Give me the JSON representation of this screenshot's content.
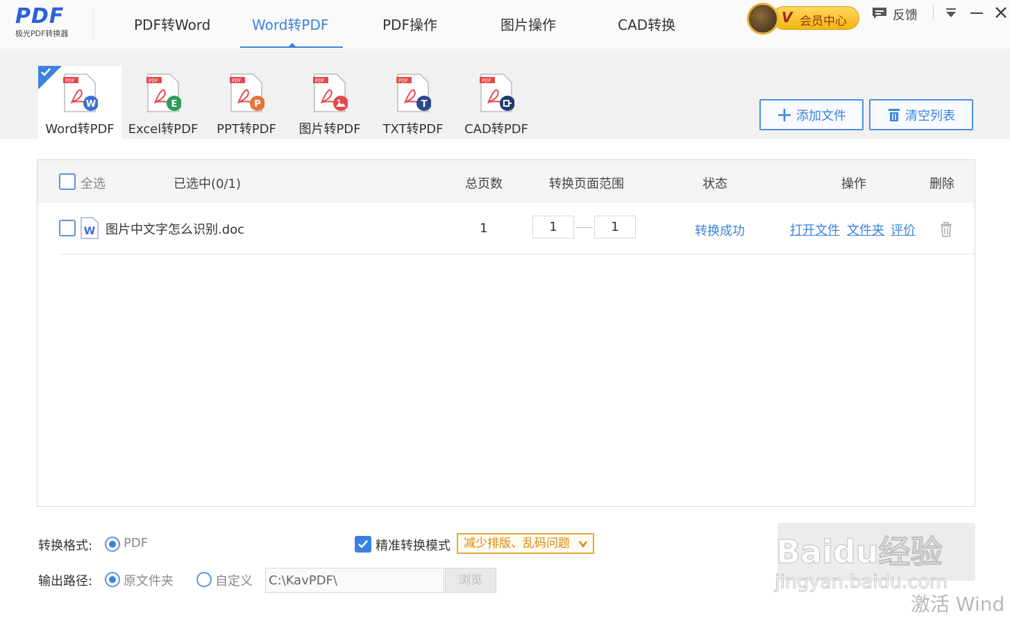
{
  "app": {
    "logo_mark": "PDF",
    "logo_sub": "极光PDF转换器"
  },
  "nav": {
    "tabs": [
      {
        "label": "PDF转Word"
      },
      {
        "label": "Word转PDF"
      },
      {
        "label": "PDF操作"
      },
      {
        "label": "图片操作"
      },
      {
        "label": "CAD转换"
      }
    ],
    "active_index": 1
  },
  "header": {
    "vip_mark": "V",
    "vip_label": "会员中心",
    "feedback_label": "反馈"
  },
  "tools": {
    "items": [
      {
        "label": "Word转PDF",
        "badge": "W",
        "badge_color": "#3b6fd6"
      },
      {
        "label": "Excel转PDF",
        "badge": "E",
        "badge_color": "#2e9a5a"
      },
      {
        "label": "PPT转PDF",
        "badge": "P",
        "badge_color": "#e4743a"
      },
      {
        "label": "图片转PDF",
        "badge": "",
        "badge_color": "#e5484d"
      },
      {
        "label": "TXT转PDF",
        "badge": "T",
        "badge_color": "#2b4a8a"
      },
      {
        "label": "CAD转PDF",
        "badge": "",
        "badge_color": "#1f3b73"
      }
    ],
    "active_index": 0,
    "doc_tag": "PDF",
    "add_file_label": "添加文件",
    "clear_list_label": "清空列表"
  },
  "table": {
    "select_all_label": "全选",
    "selected_count_label": "已选中(0/1)",
    "columns": {
      "total_pages": "总页数",
      "page_range": "转换页面范围",
      "status": "状态",
      "actions": "操作",
      "delete": "删除"
    },
    "rows": [
      {
        "checked": false,
        "file_name": "图片中文字怎么识别.doc",
        "total_pages": "1",
        "range_from": "1",
        "range_to": "1",
        "status": "转换成功",
        "action_open": "打开文件",
        "action_folder": "文件夹",
        "action_rate": "评价"
      }
    ]
  },
  "options": {
    "format_label": "转换格式:",
    "format_value": "PDF",
    "precise_mode_label": "精准转换模式",
    "precise_mode_checked": true,
    "precise_mode_tag": "减少排版、乱码问题",
    "output_label": "输出路径:",
    "output_original": "原文件夹",
    "output_custom": "自定义",
    "output_path": "C:\\KavPDF\\",
    "browse_label": "浏览"
  },
  "overlay": {
    "watermark_big": "Baidu经验",
    "watermark_url": "jingyan.baidu.com",
    "activate_text": "激活 Wind"
  },
  "colors": {
    "accent": "#3b82e0",
    "vip_gold": "#f3b516",
    "tag_orange": "#e8a63a"
  }
}
